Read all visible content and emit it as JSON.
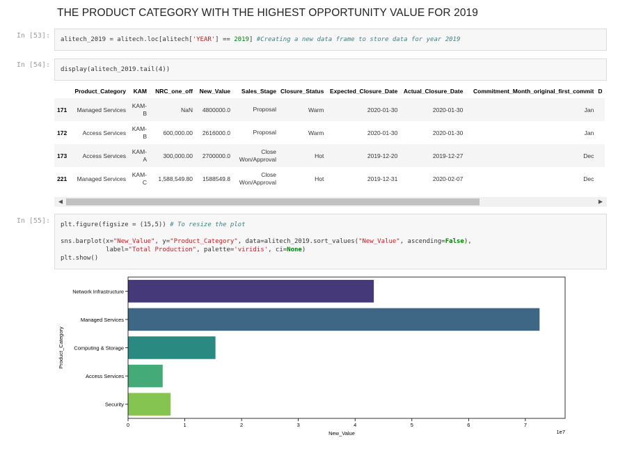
{
  "heading": "THE PRODUCT CATEGORY WITH THE HIGHEST OPPORTUNITY VALUE FOR 2019",
  "cells": [
    {
      "prompt": "In [53]:"
    },
    {
      "prompt": "In [54]:"
    },
    {
      "prompt": "In [55]:"
    }
  ],
  "code": {
    "c53": {
      "a": "alitech_2019 = alitech.loc[alitech[",
      "s": "'YEAR'",
      "b": "] == ",
      "n": "2019",
      "c": "] ",
      "com": "#Creating a new data frame to store data for year 2019"
    },
    "c54": {
      "line": "display(alitech_2019.tail(4))"
    },
    "c55": {
      "l1a": "plt.figure(figsize = (15,5)) ",
      "l1com": "# To resize the plot",
      "l3a": "sns.barplot(x=",
      "l3s1": "\"New_Value\"",
      "l3b": ", y=",
      "l3s2": "\"Product_Category\"",
      "l3c": ", data=alitech_2019.sort_values(",
      "l3s3": "\"New_Value\"",
      "l3d": ", ascending=",
      "l3k": "False",
      "l3e": "),",
      "l4a": "            label=",
      "l4s1": "\"Total Production\"",
      "l4b": ", palette=",
      "l4s2": "'viridis'",
      "l4c": ", ci=",
      "l4k": "None",
      "l4d": ")",
      "l5": "plt.show()"
    }
  },
  "table": {
    "columns": [
      "",
      "Product_Category",
      "KAM",
      "NRC_one_off",
      "New_Value",
      "Sales_Stage",
      "Closure_Status",
      "Expected_Closure_Date",
      "Actual_Closure_Date",
      "Commitment_Month_original_first_commit",
      "D"
    ],
    "rows": [
      [
        "171",
        "Managed Services",
        "KAM-B",
        "NaN",
        "4800000.0",
        "Proposal",
        "Warm",
        "2020-01-30",
        "2020-01-30",
        "Jan",
        ""
      ],
      [
        "172",
        "Access Services",
        "KAM-B",
        "600,000.00",
        "2616000.0",
        "Proposal",
        "Warm",
        "2020-01-30",
        "2020-01-30",
        "Jan",
        ""
      ],
      [
        "173",
        "Access Services",
        "KAM-A",
        "300,000.00",
        "2700000.0",
        "Close Won/Approval",
        "Hot",
        "2019-12-20",
        "2019-12-27",
        "Dec",
        ""
      ],
      [
        "221",
        "Managed Services",
        "KAM-C",
        "1,588,549.80",
        "1588549.8",
        "Close Won/Approval",
        "Hot",
        "2019-12-31",
        "2020-02-07",
        "Dec",
        ""
      ]
    ]
  },
  "scrollbar": {
    "left_icon": "arrow-left-icon",
    "right_icon": "arrow-right-icon"
  },
  "chart_data": {
    "type": "bar",
    "orientation": "horizontal",
    "categories": [
      "Network Infrastructure",
      "Managed Services",
      "Computing & Storage",
      "Access Services",
      "Security"
    ],
    "values": [
      43300000,
      72500000,
      15400000,
      6100000,
      7500000
    ],
    "colors": [
      "#46397a",
      "#3d6784",
      "#2a8a82",
      "#44aa78",
      "#86c451"
    ],
    "xlabel": "New_Value",
    "ylabel": "Product_Category",
    "x_ticks": [
      "0",
      "1",
      "2",
      "3",
      "4",
      "5",
      "6",
      "7"
    ],
    "x_offset_text": "1e7",
    "xlim": [
      0,
      77000000
    ],
    "grid": false
  }
}
